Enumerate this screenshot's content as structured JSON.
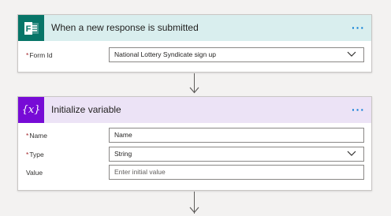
{
  "trigger": {
    "title": "When a new response is submitted",
    "menu": "···",
    "icon": "microsoft-forms-icon",
    "header_color": "#d9eeee",
    "icon_color": "#077568",
    "fields": [
      {
        "label": "Form Id",
        "required": "*",
        "value": "National Lottery Syndicate sign up",
        "type": "dropdown"
      }
    ]
  },
  "action": {
    "title": "Initialize variable",
    "menu": "···",
    "icon": "variable-icon",
    "icon_glyph": "{x}",
    "header_color": "#ece3f6",
    "icon_color": "#770bd6",
    "fields": [
      {
        "label": "Name",
        "required": "*",
        "value": "Name",
        "type": "text"
      },
      {
        "label": "Type",
        "required": "*",
        "value": "String",
        "type": "dropdown"
      },
      {
        "label": "Value",
        "required": "",
        "placeholder": "Enter initial value",
        "type": "text"
      }
    ]
  }
}
